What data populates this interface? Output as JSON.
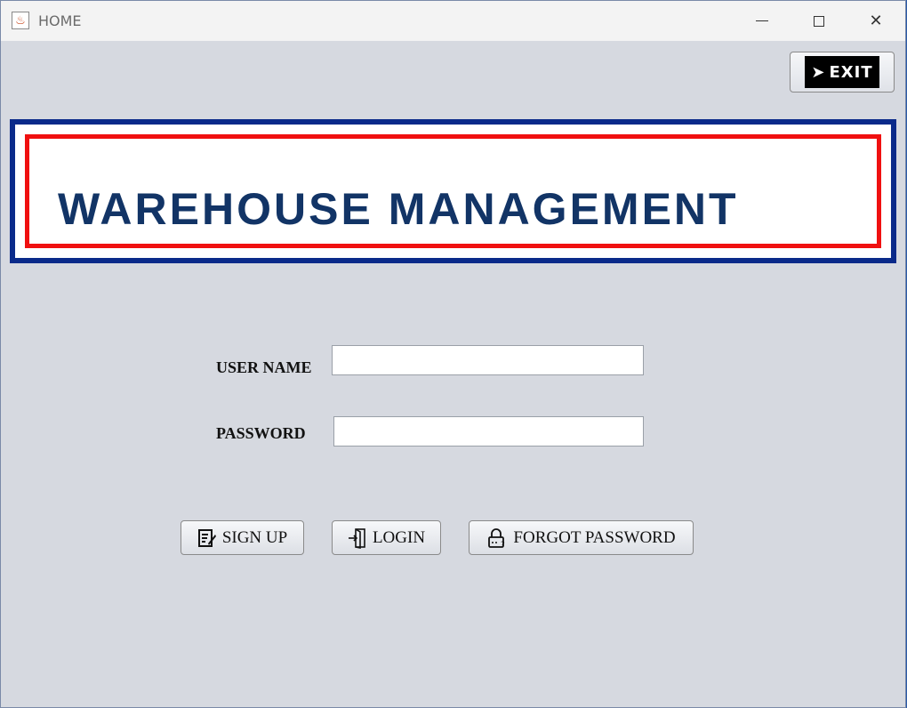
{
  "window": {
    "title": "HOME",
    "controls": {
      "minimize": "minimize",
      "maximize": "maximize",
      "close": "close"
    }
  },
  "header": {
    "exit_label": "EXIT",
    "exit_icon": "running-man-icon"
  },
  "banner": {
    "title": "WAREHOUSE MANAGEMENT",
    "outer_border_color": "#0a2a8a",
    "inner_border_color": "#f01010",
    "text_color": "#123466"
  },
  "form": {
    "username_label": "USER NAME",
    "username_value": "",
    "password_label": "PASSWORD",
    "password_value": ""
  },
  "actions": {
    "signup_label": "SIGN UP",
    "signup_icon": "edit-form-icon",
    "login_label": "LOGIN",
    "login_icon": "door-enter-icon",
    "forgot_label": "FORGOT PASSWORD",
    "forgot_icon": "lock-question-icon"
  }
}
